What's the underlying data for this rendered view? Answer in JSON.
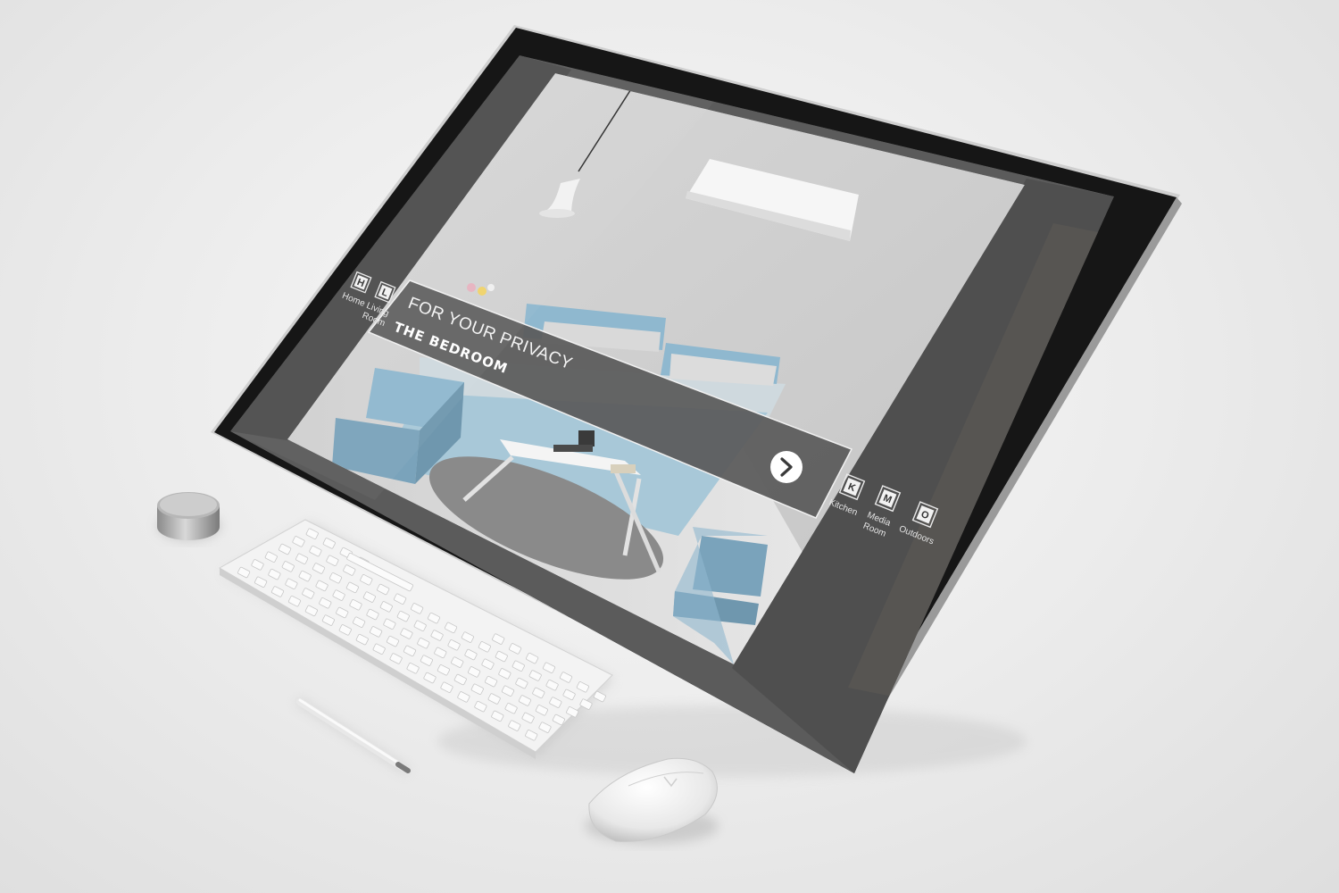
{
  "hero": {
    "tagline": "FOR YOUR PRIVACY",
    "title": "THE BEDROOM"
  },
  "nav_left": [
    {
      "letter": "H",
      "label_lines": [
        "Home"
      ]
    },
    {
      "letter": "L",
      "label_lines": [
        "Living",
        "Room"
      ]
    }
  ],
  "nav_right": [
    {
      "letter": "K",
      "label_lines": [
        "Kitchen"
      ]
    },
    {
      "letter": "M",
      "label_lines": [
        "Media",
        "Room"
      ]
    },
    {
      "letter": "O",
      "label_lines": [
        "Outdoors"
      ]
    }
  ],
  "next_button": {
    "icon": "chevron-right-icon"
  },
  "colors": {
    "panel": "#5a5a5a",
    "bezel": "#161616",
    "accent_blue": "#8fb8cf",
    "tile": "#f2f2f2"
  }
}
